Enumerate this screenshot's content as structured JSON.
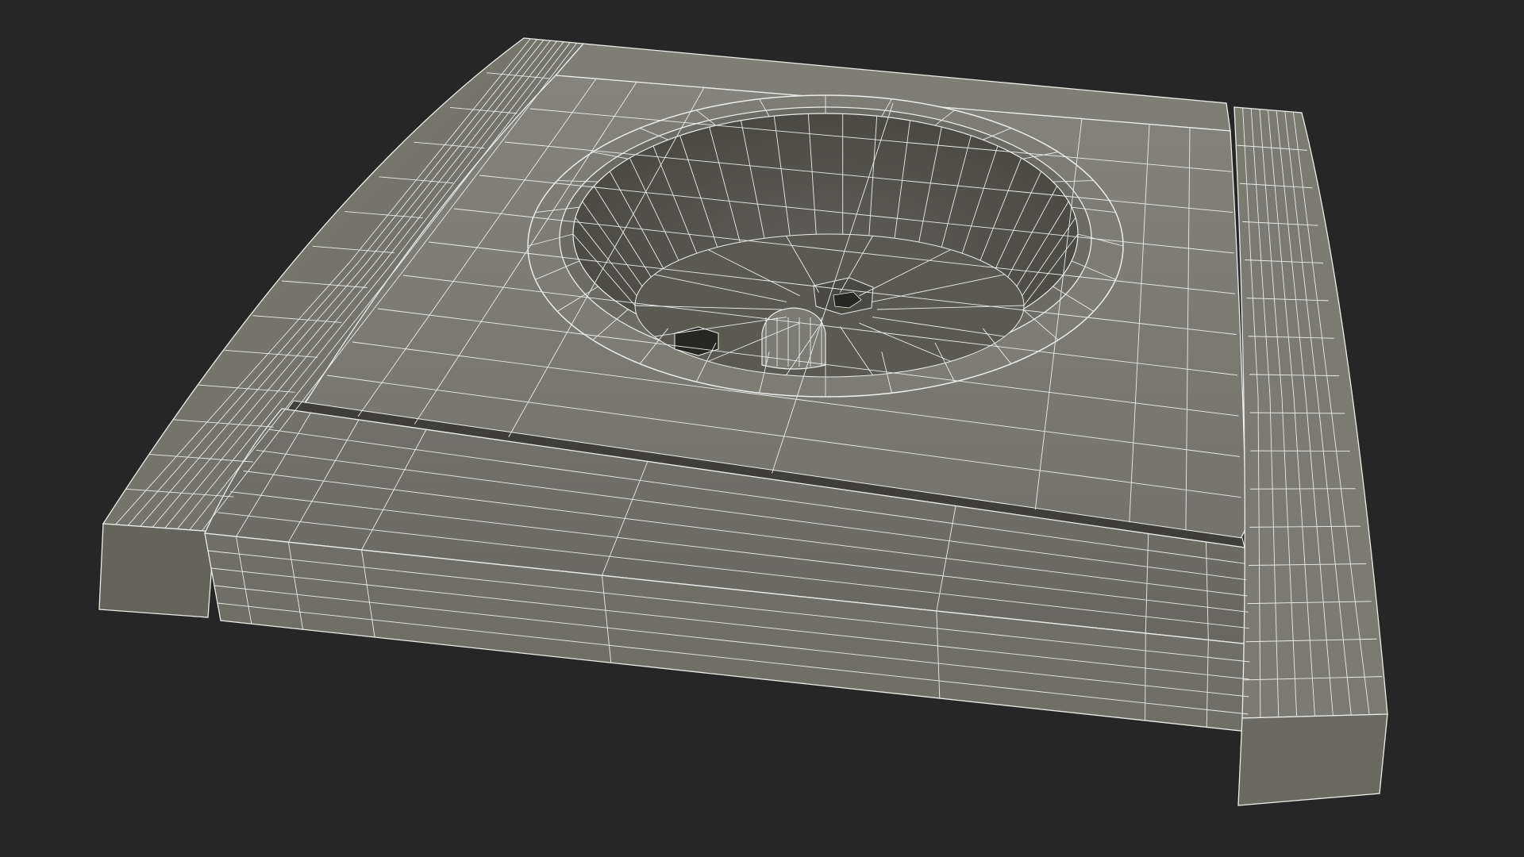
{
  "scene": {
    "subject": "socket-outlet-wireframe",
    "view": "perspective",
    "shading": "wireframe-on-shaded"
  },
  "colors": {
    "background": "#262626",
    "surface": "#76766c",
    "surface_light": "#808076",
    "surface_dark": "#65655b",
    "side": "#5c5c53",
    "cavity": "#4f4f47",
    "cavity_floor": "#5a5a51",
    "hole": "#262623",
    "wire": "#ececea",
    "groove": "#3f3f38"
  },
  "icons": {
    "model": "wireframe-mesh-icon"
  }
}
